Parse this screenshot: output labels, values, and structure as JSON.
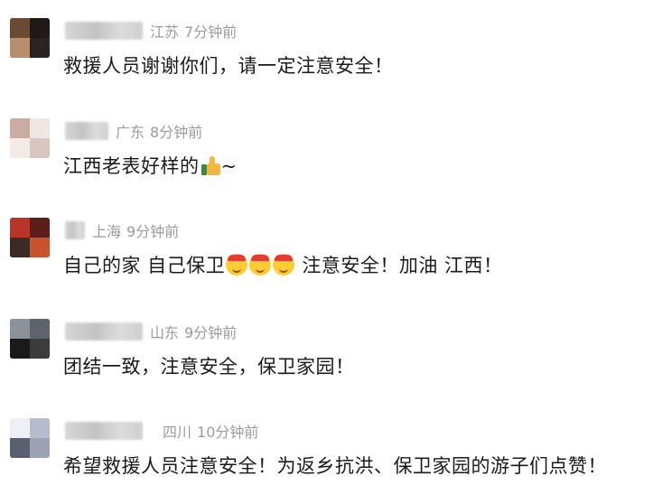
{
  "comments": [
    {
      "location": "江苏",
      "time": "7分钟前",
      "text": "救援人员谢谢你们，请一定注意安全！"
    },
    {
      "location": "广东",
      "time": "8分钟前",
      "text": "江西老表好样的",
      "suffix": "~",
      "icon": "thumbs-up-icon"
    },
    {
      "location": "上海",
      "time": "9分钟前",
      "text_before": "自己的家 自己保卫",
      "text_after": " 注意安全！加油 江西！",
      "icon": "saluting-face-icon"
    },
    {
      "location": "山东",
      "time": "9分钟前",
      "text": "团结一致，注意安全，保卫家园！"
    },
    {
      "location": "四川",
      "time": "10分钟前",
      "text": "希望救援人员注意安全！为返乡抗洪、保卫家园的游子们点赞！"
    }
  ]
}
